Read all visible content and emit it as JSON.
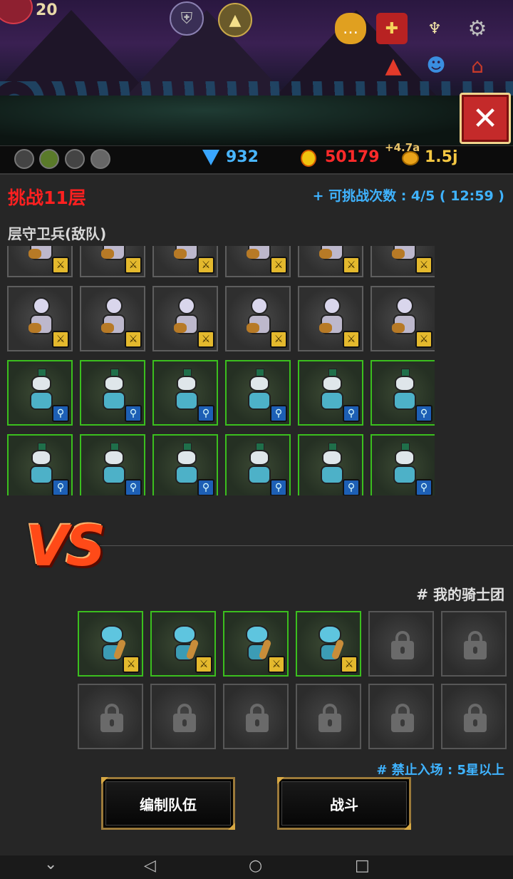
{
  "hud": {
    "level_value": "20",
    "diamonds": "932",
    "medals": "50179",
    "coin_bonus": "+4.7a",
    "coins": "1.5j"
  },
  "colors": {
    "title_red": "#ff2020",
    "info_blue": "#3fb3ff",
    "slot_green_border": "#3bbf1e",
    "close_button_red": "#c42a2a",
    "vs_orange": "#ff4a18"
  },
  "challenge": {
    "title": "挑战11层",
    "attempts_label": "+ 可挑战次数 : 4/5 ( 12:59 )",
    "enemy_section_label": "层守卫兵(敌队)"
  },
  "enemy_rows": [
    {
      "unit": "skeleton",
      "badge": "sword",
      "slots": 6
    },
    {
      "unit": "skeleton",
      "badge": "sword",
      "slots": 6
    },
    {
      "unit": "elf-mage",
      "badge": "staff",
      "slots": 6
    },
    {
      "unit": "elf-mage",
      "badge": "staff",
      "slots": 6
    }
  ],
  "versus_text": "VS",
  "my_team": {
    "label": "# 我的骑士团",
    "unlocked_units": "goblin-warrior",
    "rule_text": "# 禁止入场 : 5星以上"
  },
  "buttons": {
    "edit_team": "编制队伍",
    "battle": "战斗"
  },
  "nav": {
    "down": "⌄",
    "back": "◁",
    "home": "○",
    "recent": "□"
  }
}
